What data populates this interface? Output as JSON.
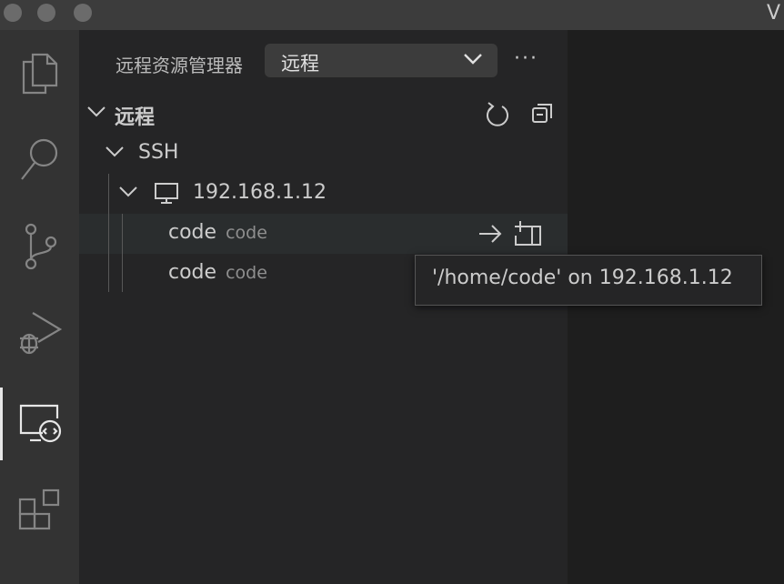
{
  "window": {
    "title_fragment": "V"
  },
  "activity_bar": {
    "items": [
      {
        "icon": "files-icon"
      },
      {
        "icon": "search-icon"
      },
      {
        "icon": "source-control-icon"
      },
      {
        "icon": "run-debug-icon"
      },
      {
        "icon": "remote-explorer-icon",
        "active": true
      },
      {
        "icon": "extensions-icon"
      }
    ]
  },
  "sidebar": {
    "title": "远程资源管理器",
    "select_value": "远程",
    "more_label": "···",
    "section": {
      "label": "远程"
    },
    "tree": {
      "group": "SSH",
      "host": "192.168.1.12",
      "folders": [
        {
          "label": "code",
          "description": "code"
        },
        {
          "label": "code",
          "description": "code"
        }
      ]
    }
  },
  "tooltip": {
    "text": "'/home/code' on 192.168.1.12"
  },
  "colors": {
    "activity_bar": "#333333",
    "sidebar": "#252526",
    "editor": "#1e1e1e",
    "titlebar": "#3c3c3c",
    "text": "#cccccc",
    "description": "#8f8f8f"
  }
}
